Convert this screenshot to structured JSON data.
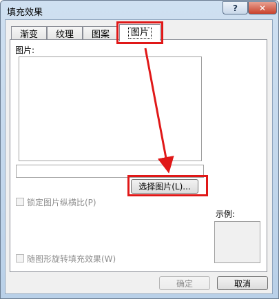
{
  "window": {
    "title": "填充效果",
    "help_label": "?",
    "close_label": "✕"
  },
  "tabs": [
    {
      "label": "渐变",
      "active": false
    },
    {
      "label": "纹理",
      "active": false
    },
    {
      "label": "图案",
      "active": false
    },
    {
      "label": "图片",
      "active": true
    }
  ],
  "picture_panel": {
    "picture_label": "图片:",
    "select_button": "选择图片(L)...",
    "lock_aspect_label": "锁定图片纵横比(P)",
    "rotate_label": "随图形旋转填充效果(W)",
    "sample_label": "示例:"
  },
  "footer": {
    "ok_label": "确定",
    "cancel_label": "取消"
  },
  "colors": {
    "highlight": "#e01818",
    "titlebar": "#c4d8ee"
  },
  "icons": {
    "close": "close-icon",
    "help": "help-icon"
  }
}
